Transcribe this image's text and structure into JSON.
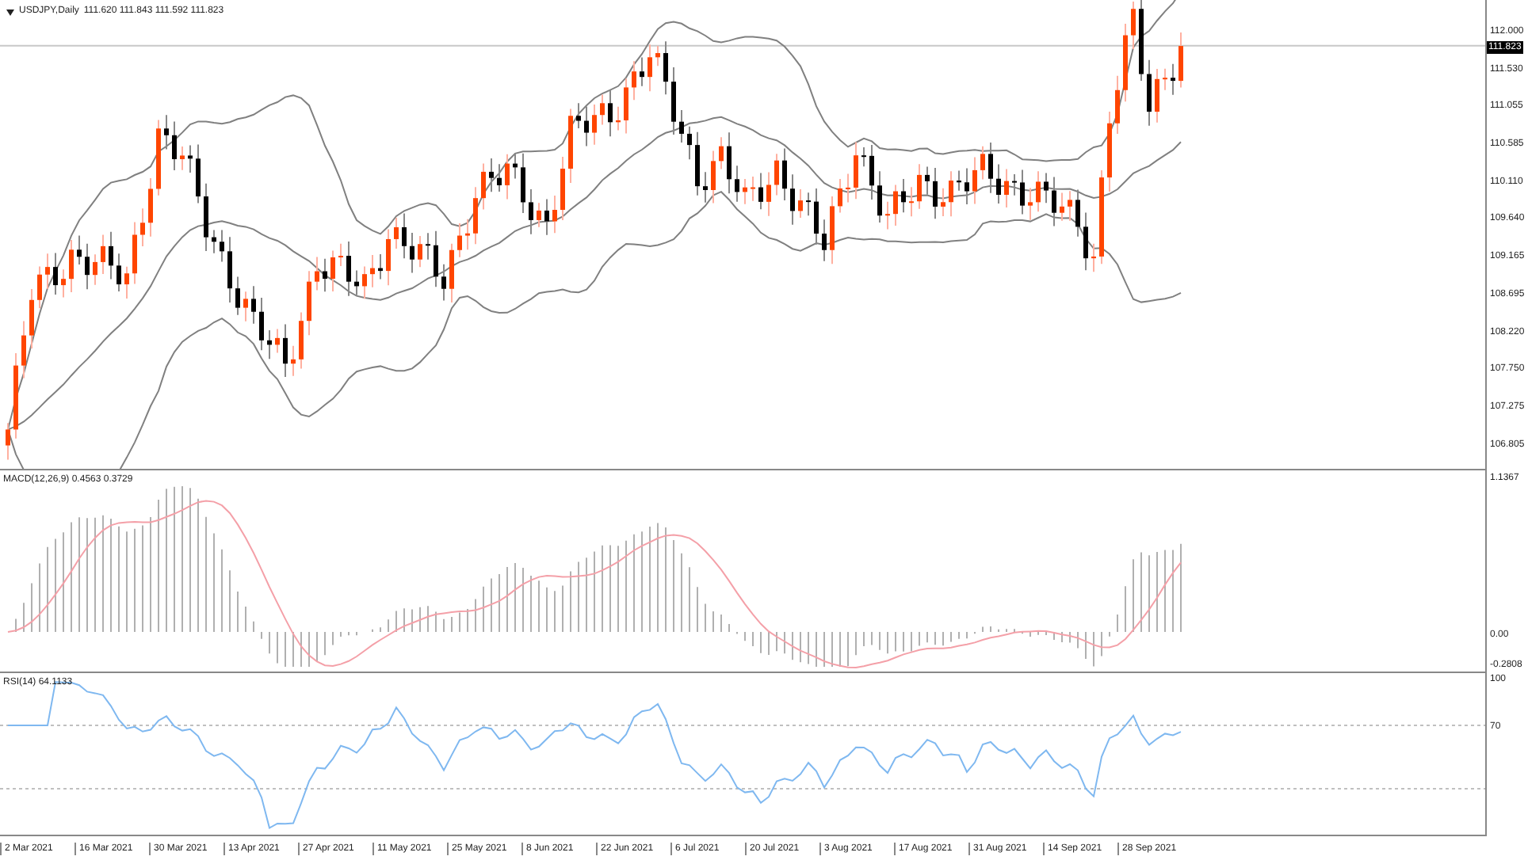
{
  "chart": {
    "symbol_title": "USDJPY,Daily",
    "ohlc": "111.620 111.843 111.592 111.823",
    "current_price": "111.823",
    "price_axis": [
      "112.000",
      "111.530",
      "111.055",
      "110.585",
      "110.110",
      "109.640",
      "109.165",
      "108.695",
      "108.220",
      "107.750",
      "107.275",
      "106.805"
    ]
  },
  "macd": {
    "title": "MACD(12,26,9) 0.4563 0.3729",
    "axis": [
      "1.1367",
      "0.00",
      "-0.2808"
    ]
  },
  "rsi": {
    "title": "RSI(14) 64.1133",
    "axis": [
      "100",
      "70"
    ]
  },
  "time_axis": [
    "2 Mar 2021",
    "16 Mar 2021",
    "30 Mar 2021",
    "13 Apr 2021",
    "27 Apr 2021",
    "11 May 2021",
    "25 May 2021",
    "8 Jun 2021",
    "22 Jun 2021",
    "6 Jul 2021",
    "20 Jul 2021",
    "3 Aug 2021",
    "17 Aug 2021",
    "31 Aug 2021",
    "14 Sep 2021",
    "28 Sep 2021"
  ]
}
